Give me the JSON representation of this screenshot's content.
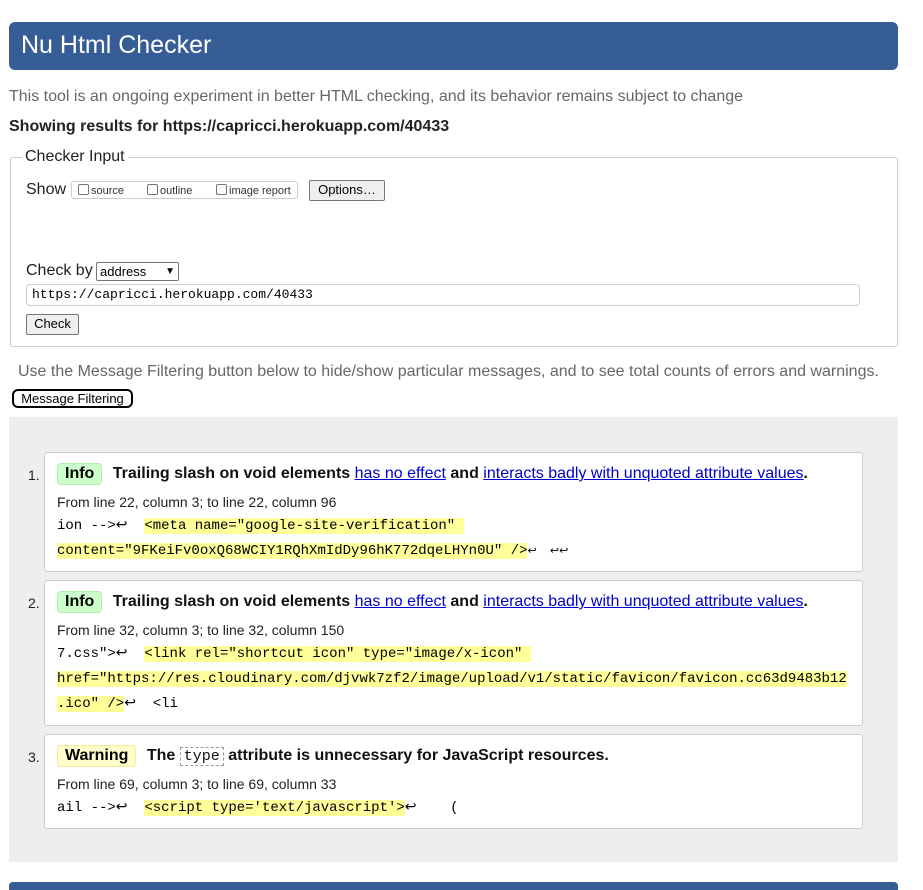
{
  "banner": {
    "title": "Nu Html Checker"
  },
  "intro": "This tool is an ongoing experiment in better HTML checking, and its behavior remains subject to change",
  "showing": {
    "prefix": "Showing results for ",
    "url": "https://capricci.herokuapp.com/40433"
  },
  "checker_input": {
    "legend": "Checker Input",
    "show_label": "Show",
    "show_options": [
      "source",
      "outline",
      "image report"
    ],
    "options_button": "Options…",
    "check_by_label": "Check by",
    "check_by_value": "address",
    "url_value": "https://capricci.herokuapp.com/40433",
    "check_button": "Check"
  },
  "filter": {
    "note": "Use the Message Filtering button below to hide/show particular messages, and to see total counts of errors and warnings.",
    "button": "Message Filtering"
  },
  "messages": [
    {
      "num": "1.",
      "type": "Info",
      "text_a": "Trailing slash on void elements ",
      "link1": "has no effect",
      "text_b": " and ",
      "link2": "interacts badly with unquoted attribute values",
      "text_c": ".",
      "location": "From line 22, column 3; to line 22, column 96",
      "extract_pre": "ion -->↩  ",
      "extract_hl_1": "<meta name=\"google-site-verification\" ",
      "extract_hl_2": "content=\"9FKeiFv0oxQ68WCIY1RQhXmIdDy96hK772dqeLHYn0U\" />",
      "extract_post": "↩  ↩↩"
    },
    {
      "num": "2.",
      "type": "Info",
      "text_a": "Trailing slash on void elements ",
      "link1": "has no effect",
      "text_b": " and ",
      "link2": "interacts badly with unquoted attribute values",
      "text_c": ".",
      "location": "From line 32, column 3; to line 32, column 150",
      "extract_pre": "7.css\">↩  ",
      "extract_hl_1": "<link rel=\"shortcut icon\" type=\"image/x-icon\" ",
      "extract_hl_2": "href=\"https://res.cloudinary.com/djvwk7zf2/image/upload/v1/static/favicon/favicon.cc63d9483b12",
      "extract_hl_3": ".ico\" />",
      "extract_post": "↩  <li"
    },
    {
      "num": "3.",
      "type": "Warning",
      "text_a": "The ",
      "code": "type",
      "text_b": " attribute is unnecessary for JavaScript resources.",
      "location": "From line 69, column 3; to line 69, column 33",
      "extract_pre": "ail -->↩  ",
      "extract_hl_1": "<script type='text/javascript'>",
      "extract_post": "↩    ("
    }
  ]
}
